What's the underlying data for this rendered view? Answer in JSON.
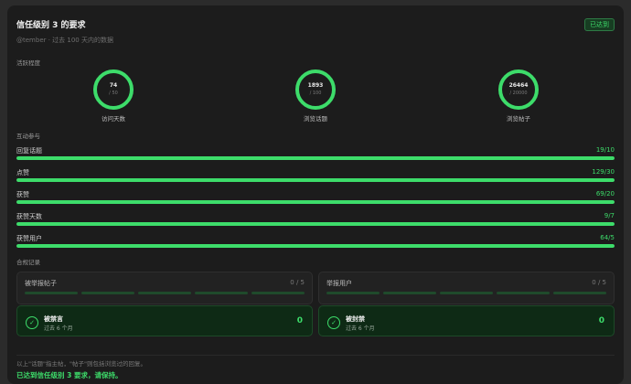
{
  "header": {
    "title": "信任级别 3 的要求",
    "badge": "已达到",
    "subtitle": "@tember · 过去 100 天内的数据"
  },
  "activity": {
    "label": "活跃程度",
    "rings": [
      {
        "value": "74",
        "max": "/ 50",
        "label": "访问天数"
      },
      {
        "value": "1893",
        "max": "/ 100",
        "label": "浏览话题"
      },
      {
        "value": "26464",
        "max": "/ 20000",
        "label": "浏览帖子"
      }
    ]
  },
  "interaction": {
    "label": "互动参与",
    "items": [
      {
        "label": "回复话题",
        "value": "19/10",
        "progress": 1.0
      },
      {
        "label": "点赞",
        "value": "129/30",
        "progress": 1.0
      },
      {
        "label": "获赞",
        "value": "69/20",
        "progress": 1.0
      },
      {
        "label": "获赞天数",
        "value": "9/7",
        "progress": 1.0
      },
      {
        "label": "获赞用户",
        "value": "64/5",
        "progress": 1.0
      }
    ]
  },
  "compliance": {
    "label": "合规记录",
    "boxes": [
      {
        "label": "被举报帖子",
        "count": "0 / 5",
        "segments": 5
      },
      {
        "label": "举报用户",
        "count": "0 / 5",
        "segments": 5
      }
    ],
    "status": [
      {
        "title": "被禁言",
        "sub": "过去 6 个月",
        "value": "0"
      },
      {
        "title": "被封禁",
        "sub": "过去 6 个月",
        "value": "0"
      }
    ]
  },
  "footer": {
    "note": "以上\"话题\"指主帖，\"帖子\"则包括浏览过的回复。",
    "result": "已达到信任级别 3 要求，请保持。"
  },
  "colors": {
    "accent": "#3ddc6a",
    "panel": "#1c1c1c",
    "background": "#2b2b2b"
  },
  "icons": {
    "status": "check-icon"
  }
}
